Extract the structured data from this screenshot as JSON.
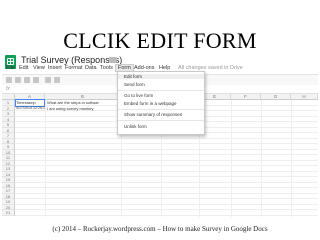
{
  "slide": {
    "title": "CLCIK EDIT FORM",
    "footer": "(c) 2014 – Rockerjay.wordpress.com – How to make Survey in Google Docs"
  },
  "sheets": {
    "doc_title": "Trial Survey (Responses)",
    "saved_status": "All changes saved in Drive",
    "formula_prefix": "fx",
    "menu": [
      "File",
      "Edit",
      "View",
      "Insert",
      "Format",
      "Data",
      "Tools",
      "Form",
      "Add-ons",
      "Help"
    ],
    "active_menu": "Form",
    "columns": [
      "A",
      "B",
      "C",
      "D",
      "E",
      "F",
      "G",
      "H"
    ],
    "rows": [
      "1",
      "2",
      "3",
      "4",
      "5",
      "6",
      "7",
      "8",
      "9",
      "10",
      "11",
      "12",
      "13",
      "14",
      "15",
      "16",
      "17",
      "18",
      "19",
      "20",
      "21"
    ],
    "cells": {
      "a1": "Timestamp",
      "b1": "What are the steps in softwar",
      "a2": "4/17/2014 12:25:16",
      "b2": "I am using survey monkey",
      "partial_text": "e?"
    },
    "form_menu": {
      "items": [
        "Edit form",
        "Send form",
        "Go to live form",
        "Embed form in a webpage",
        "Show summary of responses",
        "Unlink form"
      ]
    }
  },
  "colors": {
    "logo_green": "#0f9d58",
    "selection_blue": "#4285f4"
  }
}
